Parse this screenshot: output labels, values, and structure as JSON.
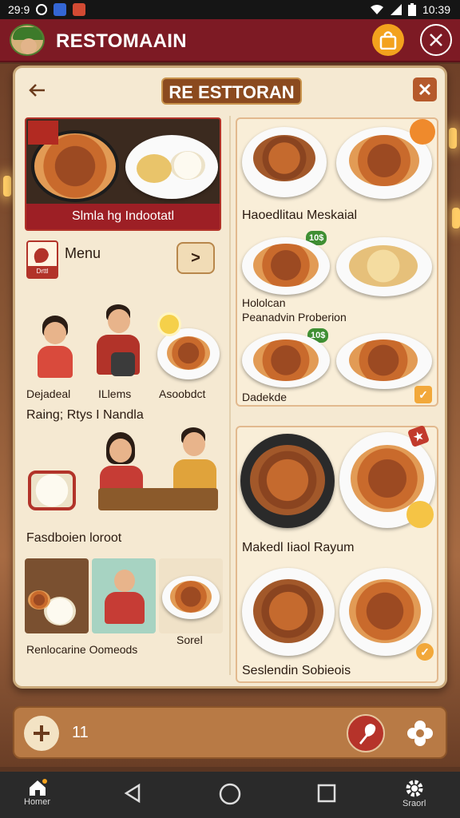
{
  "status_bar": {
    "time_left": "29:9",
    "time_right": "10:39"
  },
  "app_bar": {
    "title": "RESTOMAAIN",
    "bag_icon": "shopping-bag-icon",
    "close_icon": "close-circle-icon"
  },
  "panel": {
    "title": "RE ESTTORAN",
    "back_icon": "back-arrow-icon",
    "close_icon": "close-icon"
  },
  "left": {
    "hero_caption": "Slmla hg Indootatl",
    "menu_label": "Menu",
    "menu_tag": "Drttl",
    "menu_next": ">",
    "people_captions": [
      "Dejadeal",
      "ILlems",
      "Asoobdct"
    ],
    "section_title": "Raing; Rtys I Nandla",
    "dining_caption": "Fasdboien loroot",
    "thumb_captions": [
      "Renlocarine Oomeods",
      "Sorel"
    ]
  },
  "right": {
    "card1": {
      "title1": "Haoedlitau Meskaial",
      "price1": "10$",
      "subtitle1": "Hololcan",
      "subtitle2": "Peanadvin Proberion",
      "price2": "10$",
      "footer": "Dadekde"
    },
    "card2": {
      "title1": "Makedl Iiaol Rayum",
      "title2": "Seslendin Sobieois"
    }
  },
  "bottom_bar": {
    "add_icon": "plus-icon",
    "quantity": "11",
    "favorite_icon": "chicken-leg-icon",
    "gear_icon": "flower-settings-icon"
  },
  "nav_bar": {
    "home_label": "Homer",
    "settings_label": "Sraorl"
  },
  "colors": {
    "brand": "#7d1a24",
    "panel": "#f5e9d2",
    "accent": "#f3a21d"
  }
}
